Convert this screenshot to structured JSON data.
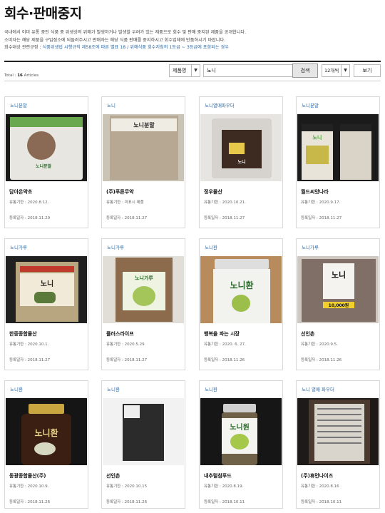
{
  "page": {
    "title": "회수·판매중지",
    "description_lines": [
      "국내에서 이미 유통 중인 식품 중 위생상의 위해가 발생하거나 발생할 우려가 있는 제품으로 회수 및 판매 중지된 제품을 공개합니다.",
      "소비자는 해당 제품을 구입점소에 되돌려주시고 판매자는 해당 식품 판매를 중지하시고 회수업체에 반품하시기 바랍니다."
    ],
    "rule_prefix": "회수대상 관련규정 : ",
    "rule_text": "식품위생법 시행규칙 제58조에 따른 별표 18 / 위해식품 회수지침의 1등급 ~ 3등급에 포함되는 경우",
    "total_label": "Total :",
    "total_count": "16",
    "total_suffix": "Articles"
  },
  "search": {
    "category_value": "제품명",
    "query_value": "노니",
    "search_button": "검색",
    "page_size_value": "12개씩",
    "view_button": "보기"
  },
  "items": [
    {
      "category": "노니분말",
      "name": "담아온약초",
      "expiry_label": "유통기한 : ",
      "expiry": "2020.8.12.",
      "reg_label": "등록일자 : ",
      "registered": "2018.11.29",
      "pack_label": "노니분말"
    },
    {
      "category": "노니",
      "name": "(주)푸른무약",
      "expiry_label": "유통기한 : ",
      "expiry": "미표시 제품",
      "reg_label": "등록일자 : ",
      "registered": "2018.11.27",
      "pack_label": "노니분말"
    },
    {
      "category": "노니열매파우더",
      "name": "정우물산",
      "expiry_label": "유통기한 : ",
      "expiry": "2020.10.21.",
      "reg_label": "등록일자 : ",
      "registered": "2018.11.27",
      "pack_label": "노니"
    },
    {
      "category": "노니분말",
      "name": "월드씨앗나라",
      "expiry_label": "유통기한 : ",
      "expiry": "2020.9.17.",
      "reg_label": "등록일자 : ",
      "registered": "2018.11.27",
      "pack_label": "노니"
    },
    {
      "category": "노니가루",
      "name": "한중종합물산",
      "expiry_label": "유통기한 : ",
      "expiry": "2020.10.1.",
      "reg_label": "등록일자 : ",
      "registered": "2018.11.27",
      "pack_label": "노니"
    },
    {
      "category": "노니가루",
      "name": "플러스라이프",
      "expiry_label": "유통기한 : ",
      "expiry": "2020.5.29",
      "reg_label": "등록일자 : ",
      "registered": "2018.11.27",
      "pack_label": "노니가루"
    },
    {
      "category": "노니환",
      "name": "행복을 파는 시장",
      "expiry_label": "유통기한 : ",
      "expiry": "2020. 6. 27.",
      "reg_label": "등록일자 : ",
      "registered": "2018.11.26",
      "pack_label": "노니환"
    },
    {
      "category": "노니가루",
      "name": "선인촌",
      "expiry_label": "유통기한 : ",
      "expiry": "2020.9.5.",
      "reg_label": "등록일자 : ",
      "registered": "2018.11.26",
      "pack_label": "노니",
      "price_label": "10,000원"
    },
    {
      "category": "노니환",
      "name": "동광종합물산(주)",
      "expiry_label": "유통기한 : ",
      "expiry": "2020.10.9.",
      "reg_label": "등록일자 : ",
      "registered": "2018.11.26",
      "pack_label": "노니환"
    },
    {
      "category": "노니환",
      "name": "선인촌",
      "expiry_label": "유통기한 : ",
      "expiry": "2020.10.15",
      "reg_label": "등록일자 : ",
      "registered": "2018.11.26",
      "pack_label": ""
    },
    {
      "category": "노니환",
      "name": "내추럴참푸드",
      "expiry_label": "유통기한 : ",
      "expiry": "2020.8.19.",
      "reg_label": "등록일자 : ",
      "registered": "2018.10.11",
      "pack_label": "노니원"
    },
    {
      "category": "노니 열매 파우더",
      "name": "(주)휴먼나이즈",
      "expiry_label": "유통기한 : ",
      "expiry": "2020.8.16",
      "reg_label": "등록일자 : ",
      "registered": "2018.10.11",
      "pack_label": ""
    }
  ],
  "colors": {
    "link_blue": "#2a6aa8"
  }
}
